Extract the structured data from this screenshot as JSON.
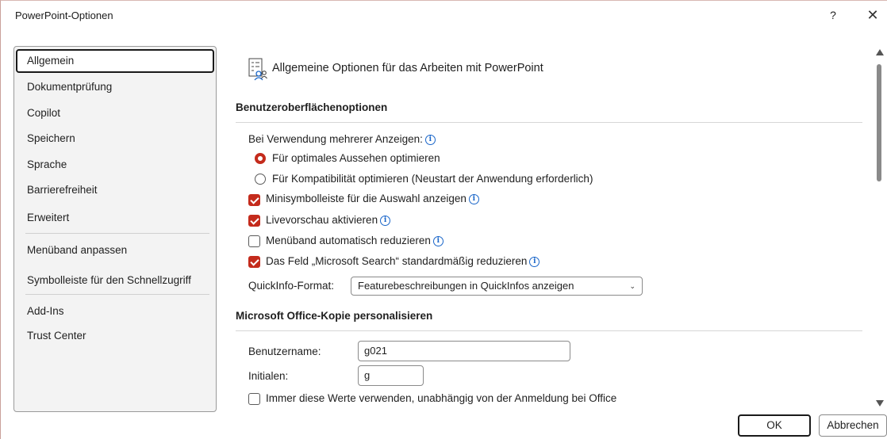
{
  "window": {
    "title": "PowerPoint-Optionen",
    "help_label": "?",
    "close_label": "✕"
  },
  "sidebar": {
    "items": [
      {
        "label": "Allgemein"
      },
      {
        "label": "Dokumentprüfung"
      },
      {
        "label": "Copilot"
      },
      {
        "label": "Speichern"
      },
      {
        "label": "Sprache"
      },
      {
        "label": "Barrierefreiheit"
      },
      {
        "label": "Erweitert"
      },
      {
        "label": "Menüband anpassen"
      },
      {
        "label": "Symbolleiste für den Schnellzugriff"
      },
      {
        "label": "Add-Ins"
      },
      {
        "label": "Trust Center"
      }
    ],
    "active_index": 0
  },
  "main": {
    "header": "Allgemeine Optionen für das Arbeiten mit PowerPoint",
    "ui_section": {
      "title": "Benutzeroberflächenoptionen",
      "multi_display_label": "Bei Verwendung mehrerer Anzeigen:",
      "radio_optimal": "Für optimales Aussehen optimieren",
      "radio_compat": "Für Kompatibilität optimieren (Neustart der Anwendung erforderlich)",
      "cb_mini_toolbar": "Minisymbolleiste für die Auswahl anzeigen",
      "cb_live_preview": "Livevorschau aktivieren",
      "cb_collapse_ribbon": "Menüband automatisch reduzieren",
      "cb_search": "Das Feld „Microsoft Search“ standardmäßig reduzieren",
      "quickinfo_label": "QuickInfo-Format:",
      "quickinfo_value": "Featurebeschreibungen in QuickInfos anzeigen"
    },
    "personalize_section": {
      "title": "Microsoft Office-Kopie personalisieren",
      "username_label": "Benutzername:",
      "username_value": "g021",
      "initials_label": "Initialen:",
      "initials_value": "g",
      "cb_always_use": "Immer diese Werte verwenden, unabhängig von der Anmeldung bei Office"
    }
  },
  "footer": {
    "ok_label": "OK",
    "cancel_label": "Abbrechen"
  },
  "colors": {
    "accent": "#c42b1c",
    "info": "#1a66c9"
  }
}
